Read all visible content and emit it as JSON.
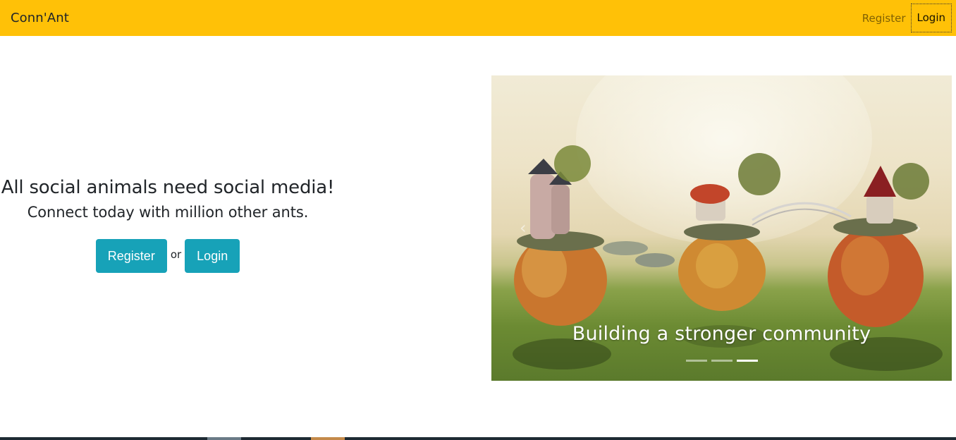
{
  "navbar": {
    "brand": "Conn'Ant",
    "links": {
      "register": "Register",
      "login": "Login"
    },
    "background": "#ffc107"
  },
  "hero": {
    "title": "All social animals need social media!",
    "subtitle": "Connect today with million other ants.",
    "register_label": "Register",
    "or_text": "or",
    "login_label": "Login",
    "button_color": "#17a2b8"
  },
  "carousel": {
    "caption": "Building a stronger community",
    "prev_icon": "chevron-left-icon",
    "next_icon": "chevron-right-icon",
    "prev_glyph": "‹",
    "next_glyph": "›",
    "slide_count": 3,
    "active_index": 3
  }
}
